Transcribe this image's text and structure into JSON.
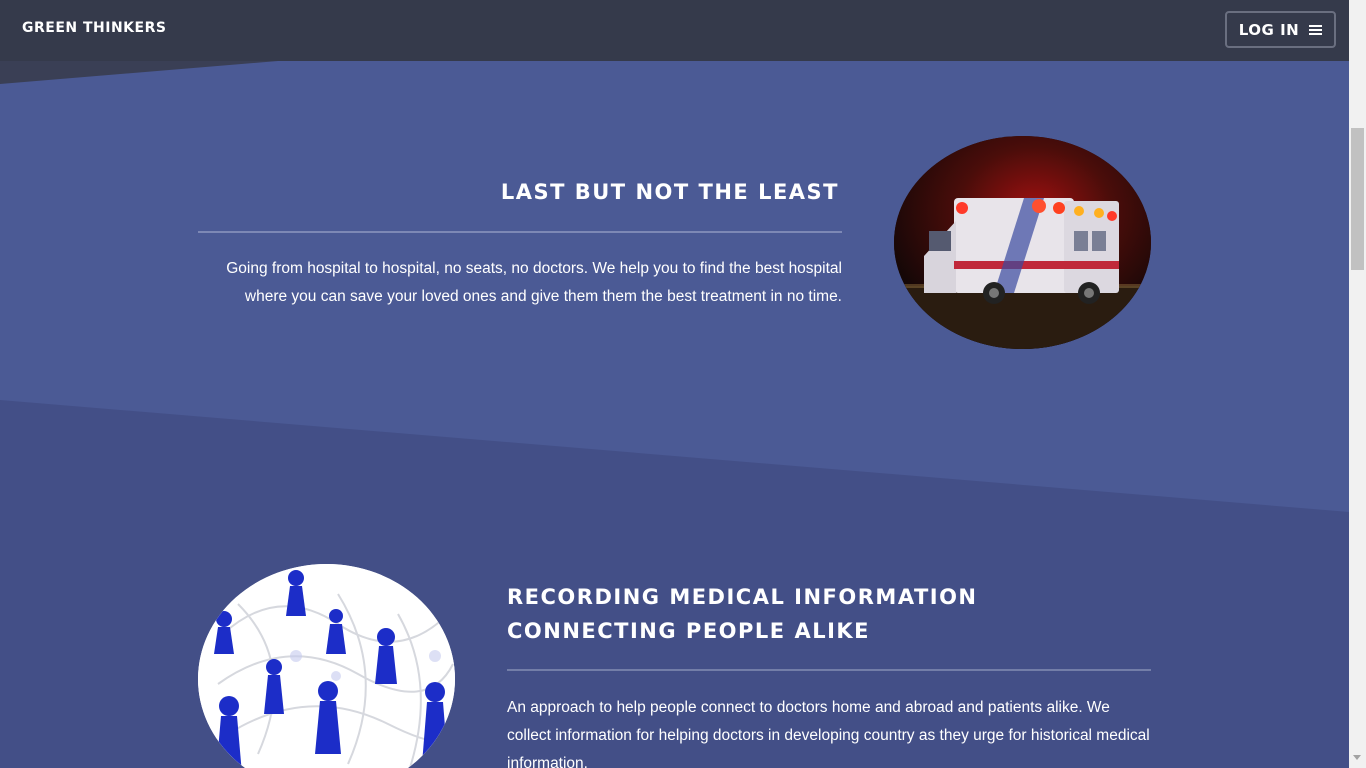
{
  "navbar": {
    "brand": "GREEN THINKERS",
    "login_label": "LOG IN",
    "menu_icon": "hamburger-menu-icon"
  },
  "section1": {
    "title": "LAST BUT NOT THE LEAST",
    "text": "Going from hospital to hospital, no seats, no doctors. We help you to find the best hospital where you can save your loved ones and give them them the best treatment in no time."
  },
  "section2": {
    "title": "RECORDING MEDICAL INFORMATION CONNECTING PEOPLE ALIKE",
    "text": "An approach to help people connect to doctors home and abroad and patients alike. We collect information for helping doctors in developing country as they urge for historical medical information."
  },
  "colors": {
    "navbar_bg": "#353a4b",
    "section_upper_bg": "#4b5a95",
    "section_lower_bg": "#434f87",
    "text": "#ffffff"
  }
}
